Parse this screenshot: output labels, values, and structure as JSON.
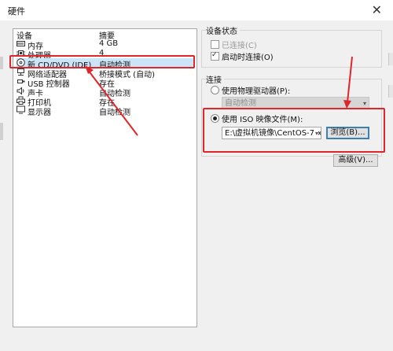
{
  "window": {
    "title": "硬件",
    "close_glyph": "✕"
  },
  "device_list": {
    "headers": {
      "device": "设备",
      "summary": "摘要"
    },
    "rows": [
      {
        "name": "内存",
        "summary": "4 GB",
        "icon": "memory-icon"
      },
      {
        "name": "处理器",
        "summary": "4",
        "icon": "cpu-icon"
      },
      {
        "name": "新 CD/DVD (IDE)",
        "summary": "自动检测",
        "icon": "cd-icon",
        "selected": true
      },
      {
        "name": "网络适配器",
        "summary": "桥接模式 (自动)",
        "icon": "network-icon"
      },
      {
        "name": "USB 控制器",
        "summary": "存在",
        "icon": "usb-icon"
      },
      {
        "name": "声卡",
        "summary": "自动检测",
        "icon": "sound-icon"
      },
      {
        "name": "打印机",
        "summary": "存在",
        "icon": "printer-icon"
      },
      {
        "name": "显示器",
        "summary": "自动检测",
        "icon": "display-icon"
      }
    ]
  },
  "device_status": {
    "title": "设备状态",
    "connected": {
      "label": "已连接(C)",
      "checked": false,
      "enabled": false
    },
    "connect_on_power_on": {
      "label": "启动时连接(O)",
      "checked": true
    }
  },
  "connection": {
    "title": "连接",
    "physical_drive": {
      "label": "使用物理驱动器(P):",
      "value": "自动检测",
      "selected": false
    },
    "iso_image": {
      "label": "使用 ISO 映像文件(M):",
      "value": "E:\\虚拟机镜像\\CentOS-7-x86_",
      "selected": true
    },
    "browse_label": "浏览(B)...",
    "advanced_label": "高级(V)..."
  },
  "colors": {
    "annotation_red": "#e0262a",
    "selection": "#cce4f7",
    "dialog_bg": "#f0f0f0"
  }
}
